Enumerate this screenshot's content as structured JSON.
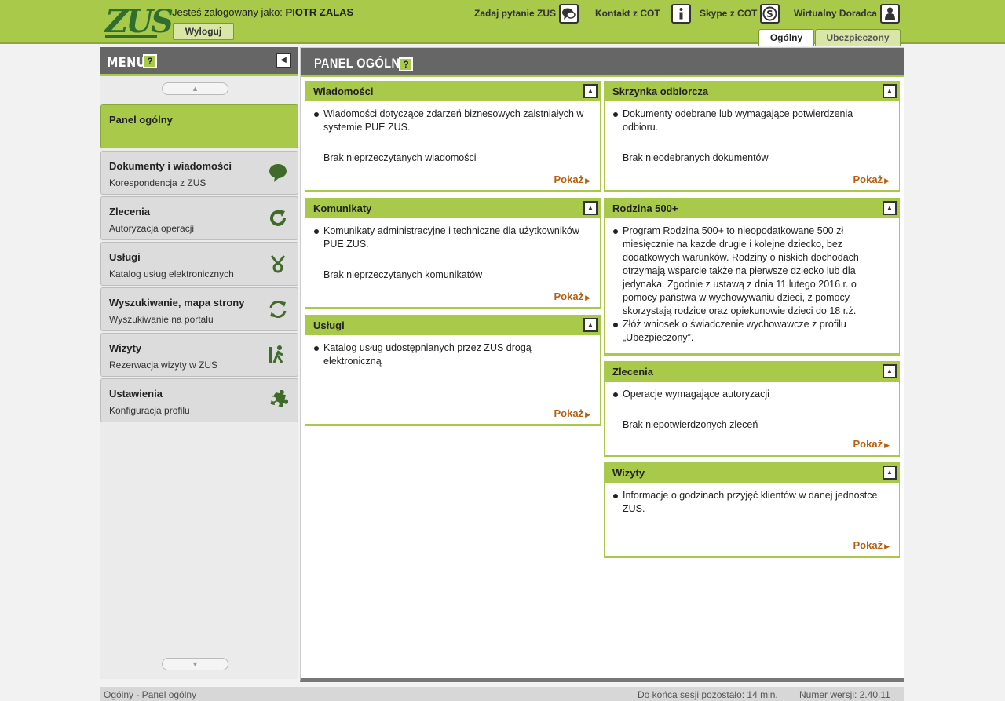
{
  "header": {
    "logo_text": "ZUS",
    "login_prefix": "Jesteś zalogowany jako:",
    "user_name": "PIOTR ZALAS",
    "logout_label": "Wyloguj",
    "links": [
      {
        "label": "Zadaj pytanie ZUS",
        "icon": "chat-bubbles-icon"
      },
      {
        "label": "Kontakt z COT",
        "icon": "info-icon"
      },
      {
        "label": "Skype z COT",
        "icon": "skype-icon"
      },
      {
        "label": "Wirtualny Doradca",
        "icon": "person-icon"
      }
    ],
    "tabs": [
      "Ogólny",
      "Ubezpieczony"
    ]
  },
  "sidebar": {
    "title": "MENU",
    "help": "?",
    "collapse": "◀",
    "scroll_up": "▲",
    "scroll_down": "▼",
    "items": [
      {
        "title": "Panel ogólny",
        "sub": ""
      },
      {
        "title": "Dokumenty i wiadomości",
        "sub": "Korespondencja z ZUS",
        "icon": "speech-bubble-icon"
      },
      {
        "title": "Zlecenia",
        "sub": "Autoryzacja operacji",
        "icon": "refresh-icon"
      },
      {
        "title": "Usługi",
        "sub": "Katalog usług elektronicznych",
        "icon": "services-icon"
      },
      {
        "title": "Wyszukiwanie, mapa strony",
        "sub": "Wyszukiwanie na portalu",
        "icon": "sync-icon"
      },
      {
        "title": "Wizyty",
        "sub": "Rezerwacja wizyty w ZUS",
        "icon": "walking-person-icon"
      },
      {
        "title": "Ustawienia",
        "sub": "Konfiguracja profilu",
        "icon": "puzzle-icon"
      }
    ]
  },
  "main": {
    "title": "PANEL OGÓLNY",
    "help": "?",
    "pokaz_label": "Pokaż",
    "panels": {
      "wiadomosci": {
        "title": "Wiadomości",
        "bullets": [
          "Wiadomości dotyczące zdarzeń biznesowych zaistniałych w systemie PUE ZUS."
        ],
        "status": "Brak nieprzeczytanych wiadomości"
      },
      "komunikaty": {
        "title": "Komunikaty",
        "bullets": [
          "Komunikaty administracyjne i techniczne dla użytkowników PUE ZUS."
        ],
        "status": "Brak nieprzeczytanych komunikatów"
      },
      "uslugi": {
        "title": "Usługi",
        "bullets": [
          "Katalog usług udostępnianych przez ZUS drogą elektroniczną"
        ]
      },
      "skrzynka": {
        "title": "Skrzynka odbiorcza",
        "bullets": [
          "Dokumenty odebrane lub wymagające potwierdzenia odbioru."
        ],
        "status": "Brak nieodebranych dokumentów"
      },
      "rodzina": {
        "title": "Rodzina 500+",
        "bullets": [
          "Program Rodzina 500+ to nieopodatkowane 500 zł miesięcznie na każde drugie i kolejne dziecko, bez dodatkowych warunków. Rodziny o niskich dochodach otrzymają wsparcie także na pierwsze dziecko lub dla jedynaka. Zgodnie z ustawą z dnia 11 lutego 2016 r. o pomocy państwa w wychowywaniu dzieci, z pomocy skorzystają rodzice oraz opiekunowie dzieci do 18 r.ż.",
          "Złóż wniosek o świadczenie wychowawcze z profilu „Ubezpieczony”."
        ]
      },
      "zlecenia": {
        "title": "Zlecenia",
        "bullets": [
          "Operacje wymagające autoryzacji"
        ],
        "status": "Brak niepotwierdzonych zleceń"
      },
      "wizyty": {
        "title": "Wizyty",
        "bullets": [
          "Informacje o godzinach przyjęć klientów w danej jednostce ZUS."
        ]
      }
    }
  },
  "footer": {
    "breadcrumb": "Ogólny - Panel ogólny",
    "session": "Do końca sesji pozostało: 14 min.",
    "version": "Numer wersji: 2.40.11"
  }
}
